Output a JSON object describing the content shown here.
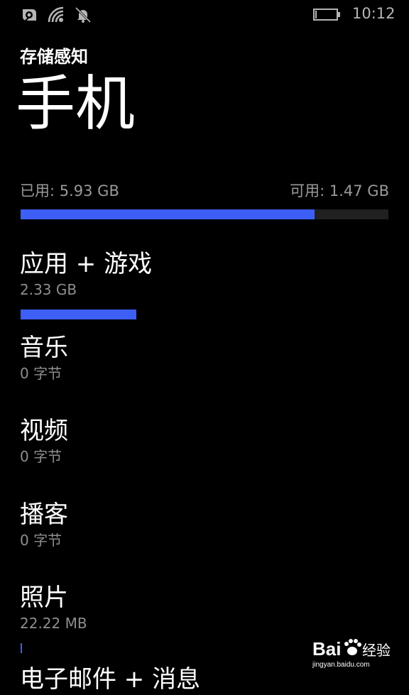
{
  "status_bar": {
    "time": "10:12",
    "icons": [
      "data-sense-icon",
      "wifi-icon",
      "quiet-hours-bell-icon",
      "battery-icon"
    ],
    "battery_level": 0.05
  },
  "header": {
    "app_title": "存储感知",
    "page_title": "手机"
  },
  "summary": {
    "used_label": "已用: 5.93 GB",
    "free_label": "可用: 1.47 GB",
    "used_fraction": 0.8,
    "bar_color": "#3d5ff5",
    "track_color": "#202020"
  },
  "categories": [
    {
      "name": "应用 + 游戏",
      "size": "2.33 GB",
      "fraction": 0.315
    },
    {
      "name": "音乐",
      "size": "0 字节",
      "fraction": 0
    },
    {
      "name": "视频",
      "size": "0 字节",
      "fraction": 0
    },
    {
      "name": "播客",
      "size": "0 字节",
      "fraction": 0
    },
    {
      "name": "照片",
      "size": "22.22 MB",
      "fraction": 0.004
    },
    {
      "name": "电子邮件 + 消息",
      "size": "",
      "fraction": 0
    }
  ],
  "watermark": {
    "logo_text": "Bai",
    "logo_text_2": "经验",
    "url": "jingyan.baidu.com"
  }
}
